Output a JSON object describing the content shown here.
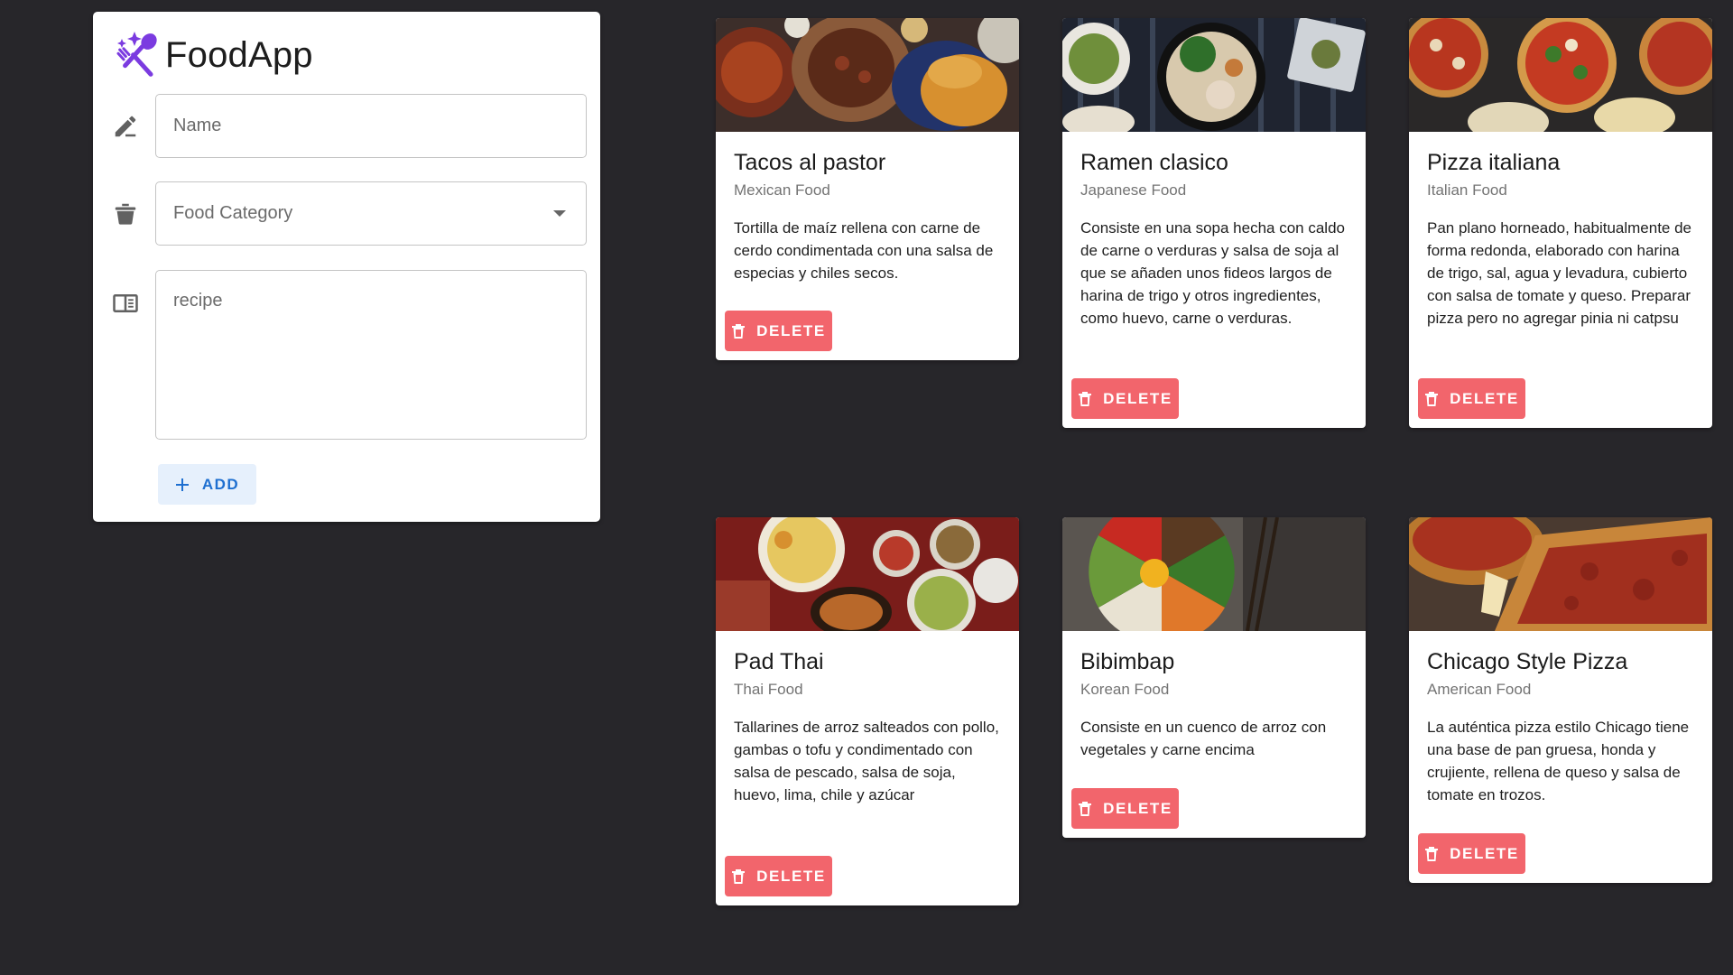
{
  "app": {
    "title": "FoodApp",
    "logo_icon": "fork-spoon-sparkles-icon",
    "accent_color": "#7b3be0"
  },
  "form": {
    "name_placeholder": "Name",
    "name_icon": "pencil-icon",
    "category_placeholder": "Food Category",
    "category_icon": "pot-icon",
    "recipe_placeholder": "recipe",
    "recipe_icon": "book-open-icon",
    "add_label": "ADD",
    "add_icon": "plus-icon"
  },
  "colors": {
    "page_background": "#27262a",
    "delete_button": "#f2656c",
    "add_button_bg": "#e6f0fc",
    "add_button_text": "#1e6fd0"
  },
  "cards": [
    {
      "title": "Tacos al pastor",
      "category": "Mexican Food",
      "description": "Tortilla de maíz rellena con carne de cerdo condimentada con una salsa de especias y chiles secos.",
      "delete_label": "DELETE"
    },
    {
      "title": "Ramen clasico",
      "category": "Japanese Food",
      "description": "Consiste en una sopa hecha con caldo de carne o verduras y salsa de soja al que se añaden unos fideos largos de harina de trigo y otros ingredientes, como huevo, carne o verduras.",
      "delete_label": "DELETE"
    },
    {
      "title": "Pizza italiana",
      "category": "Italian Food",
      "description": "Pan plano horneado, habitualmente de forma redonda, elaborado con harina de trigo, sal, agua y levadura, cubierto con salsa de tomate y queso. Preparar pizza pero no agregar pinia ni catpsu",
      "delete_label": "DELETE"
    },
    {
      "title": "Pad Thai",
      "category": "Thai Food",
      "description": "Tallarines de arroz salteados con pollo, gambas o tofu y condimentado con salsa de pescado, salsa de soja, huevo, lima, chile y azúcar",
      "delete_label": "DELETE"
    },
    {
      "title": "Bibimbap",
      "category": "Korean Food",
      "description": "Consiste en un cuenco de arroz con vegetales y carne encima",
      "delete_label": "DELETE"
    },
    {
      "title": "Chicago Style Pizza",
      "category": "American Food",
      "description": "La auténtica pizza estilo Chicago tiene una base de pan gruesa, honda y crujiente, rellena de queso y salsa de tomate en trozos.",
      "delete_label": "DELETE"
    }
  ]
}
